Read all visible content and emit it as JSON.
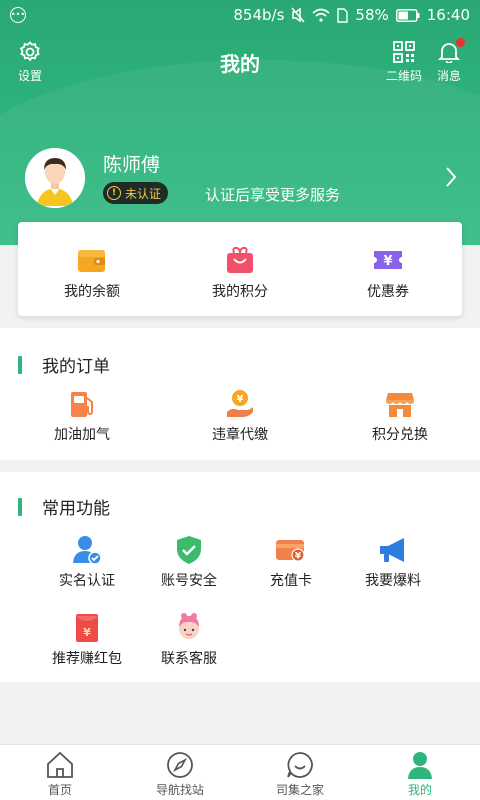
{
  "status_bar": {
    "speed": "854b/s",
    "battery": "58%",
    "time": "16:40"
  },
  "header": {
    "title": "我的",
    "settings_label": "设置",
    "qrcode_label": "二维码",
    "message_label": "消息"
  },
  "profile": {
    "name": "陈师傅",
    "badge": "未认证",
    "tip": "认证后享受更多服务"
  },
  "wallet": {
    "items": [
      {
        "label": "我的余额",
        "icon": "wallet-icon"
      },
      {
        "label": "我的积分",
        "icon": "gift-bag-icon"
      },
      {
        "label": "优惠券",
        "icon": "coupon-icon"
      }
    ]
  },
  "orders": {
    "title": "我的订单",
    "items": [
      {
        "label": "加油加气",
        "icon": "fuel-pump-icon"
      },
      {
        "label": "违章代缴",
        "icon": "hand-coin-icon"
      },
      {
        "label": "积分兑换",
        "icon": "shop-icon"
      }
    ]
  },
  "functions": {
    "title": "常用功能",
    "items": [
      {
        "label": "实名认证",
        "icon": "verified-user-icon"
      },
      {
        "label": "账号安全",
        "icon": "shield-check-icon"
      },
      {
        "label": "充值卡",
        "icon": "recharge-card-icon"
      },
      {
        "label": "我要爆料",
        "icon": "megaphone-icon"
      },
      {
        "label": "推荐赚红包",
        "icon": "red-packet-icon"
      },
      {
        "label": "联系客服",
        "icon": "customer-service-icon"
      }
    ]
  },
  "tabbar": {
    "items": [
      {
        "label": "首页",
        "icon": "home-icon",
        "active": false
      },
      {
        "label": "导航找站",
        "icon": "compass-icon",
        "active": false
      },
      {
        "label": "司集之家",
        "icon": "community-icon",
        "active": false
      },
      {
        "label": "我的",
        "icon": "person-icon",
        "active": true
      }
    ]
  },
  "colors": {
    "primary": "#2eb47c",
    "badge_bg": "#1e2b26",
    "badge_text": "#f5c842"
  }
}
